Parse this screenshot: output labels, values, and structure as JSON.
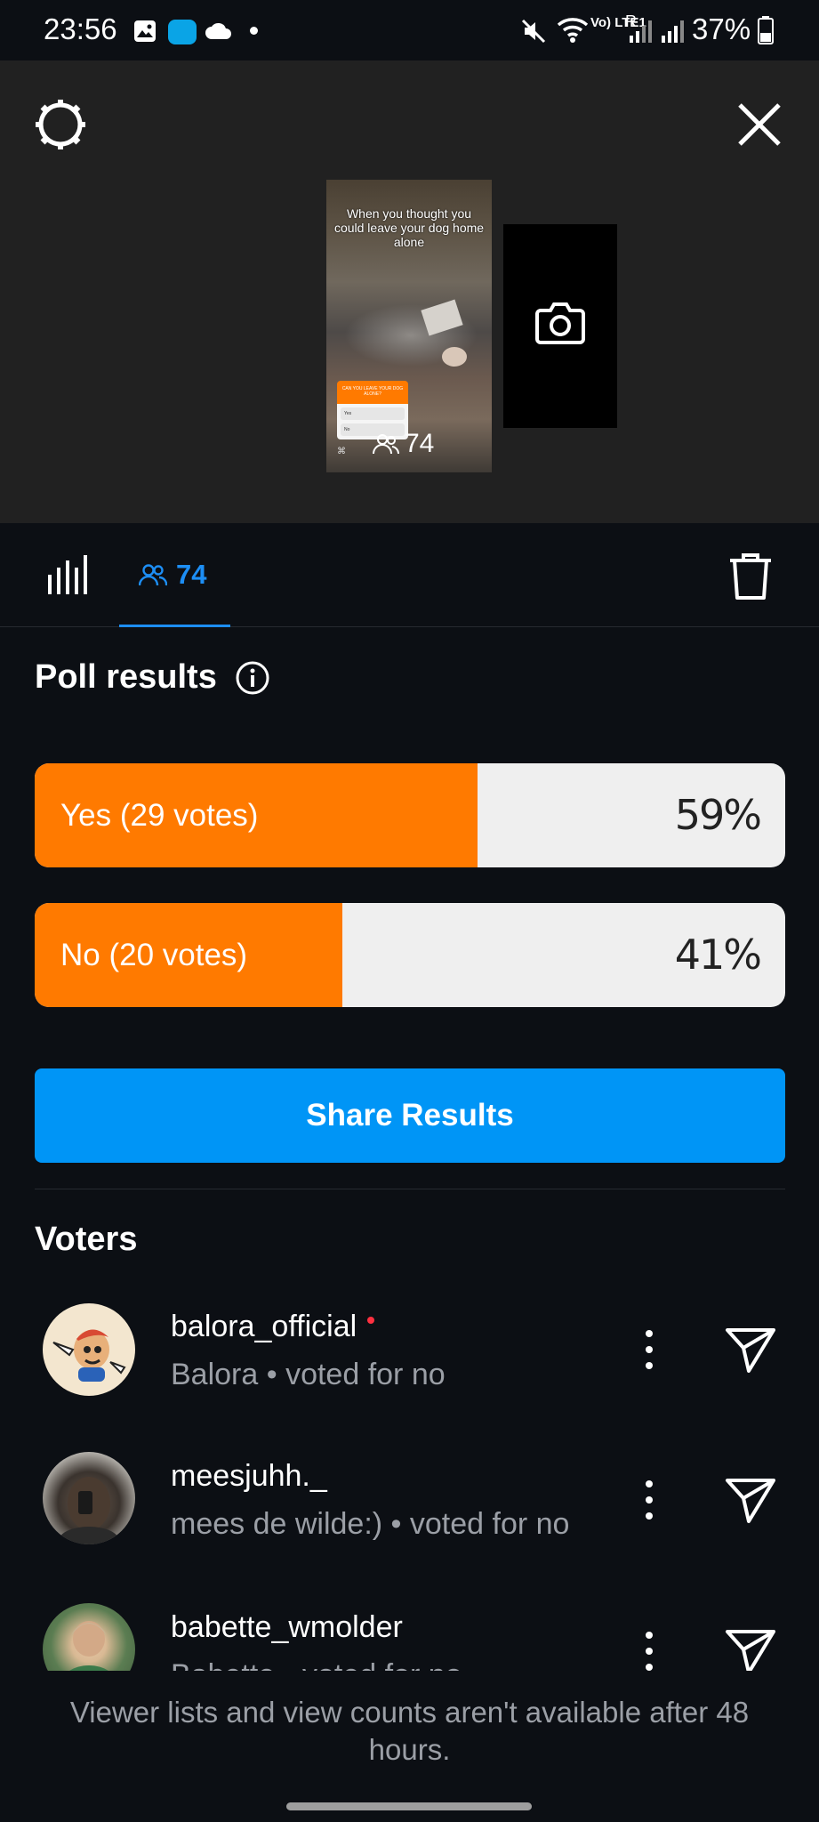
{
  "status_bar": {
    "time": "23:56",
    "battery": "37%",
    "network_label": "Vo) LTE1",
    "roaming": "R"
  },
  "story": {
    "caption": "When you thought you could leave your dog home alone",
    "mini_poll_question": "CAN YOU LEAVE YOUR DOG ALONE?",
    "mini_poll_options": [
      "Yes",
      "No"
    ],
    "viewer_count": "74"
  },
  "tabs": {
    "viewers_count": "74",
    "active": "viewers"
  },
  "poll": {
    "title": "Poll results",
    "options": [
      {
        "label": "Yes (29 votes)",
        "percent_text": "59%",
        "fraction": 0.59
      },
      {
        "label": "No (20 votes)",
        "percent_text": "41%",
        "fraction": 0.41
      }
    ]
  },
  "share_button": "Share Results",
  "voters": {
    "title": "Voters",
    "items": [
      {
        "username": "balora_official",
        "name": "Balora",
        "vote": "voted for no",
        "meta": "Balora • voted for no",
        "has_live_dot": true
      },
      {
        "username": "meesjuhh._",
        "name": "mees de wilde:)",
        "vote": "voted for no",
        "meta": "mees de wilde:) • voted for no",
        "has_live_dot": false
      },
      {
        "username": "babette_wmolder",
        "name": "Babette",
        "vote": "voted for no",
        "meta": "Babette • voted for no",
        "has_live_dot": false
      }
    ]
  },
  "footer_note": "Viewer lists and view counts aren't available after 48 hours.",
  "colors": {
    "accent_blue": "#0095f6",
    "tab_blue": "#1d8ef5",
    "poll_orange": "#ff7a00",
    "background": "#0c0f14",
    "top_area": "#212121"
  },
  "icons": [
    "gear-icon",
    "close-icon",
    "camera-icon",
    "stats-icon",
    "viewers-icon",
    "trash-icon",
    "info-icon",
    "more-icon",
    "send-icon"
  ]
}
